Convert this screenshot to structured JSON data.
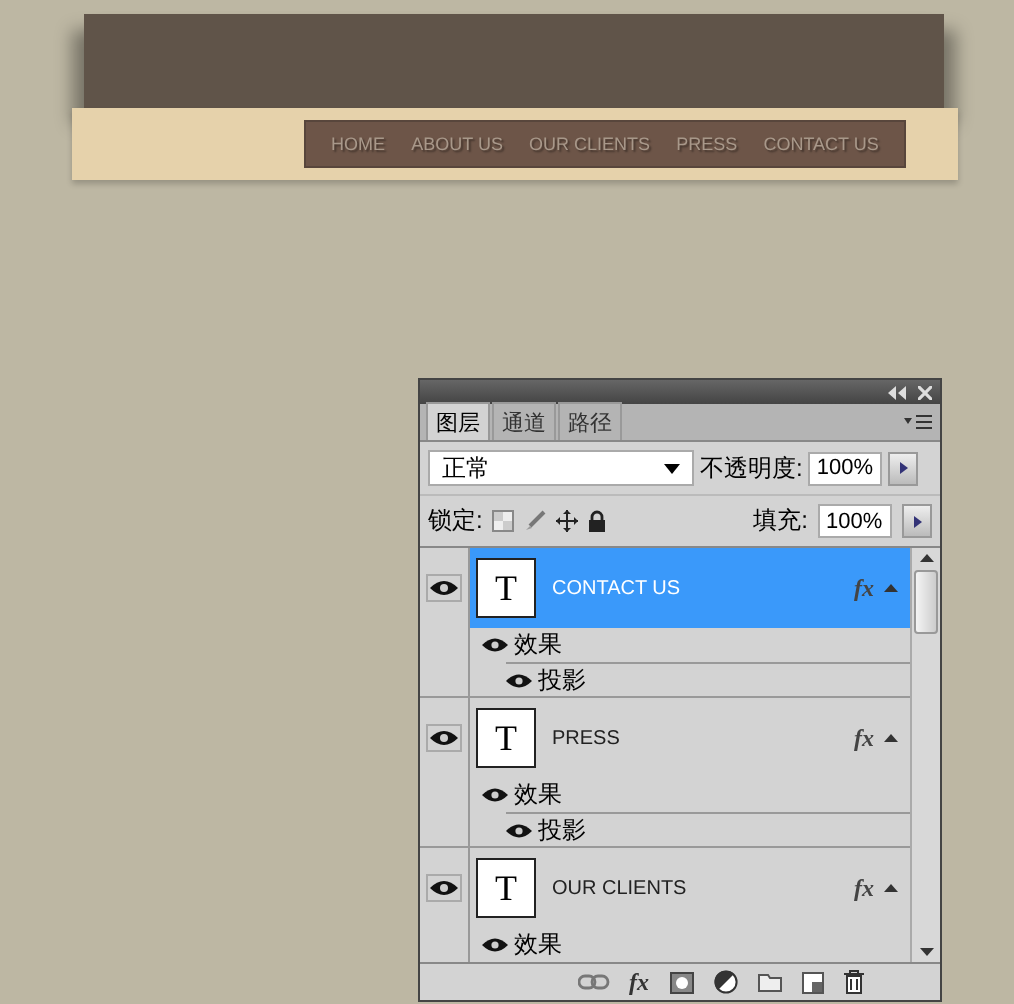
{
  "nav": {
    "items": [
      "HOME",
      "ABOUT US",
      "OUR CLIENTS",
      "PRESS",
      "CONTACT US"
    ]
  },
  "layers_panel": {
    "tabs": [
      {
        "label": "图层",
        "selected": true
      },
      {
        "label": "通道",
        "selected": false
      },
      {
        "label": "路径",
        "selected": false
      }
    ],
    "blend_mode": "正常",
    "opacity_label": "不透明度:",
    "opacity": "100%",
    "lock_label": "锁定:",
    "fill_label": "填充:",
    "fill": "100%",
    "layers": [
      {
        "thumb": "T",
        "name": "CONTACT US",
        "selected": true,
        "visible": true,
        "fx": "fx",
        "effects_label": "效果",
        "effects": [
          {
            "name": "投影",
            "visible": true
          }
        ]
      },
      {
        "thumb": "T",
        "name": "PRESS",
        "selected": false,
        "visible": true,
        "fx": "fx",
        "effects_label": "效果",
        "effects": [
          {
            "name": "投影",
            "visible": true
          }
        ]
      },
      {
        "thumb": "T",
        "name": "OUR CLIENTS",
        "selected": false,
        "visible": true,
        "fx": "fx",
        "effects_label": "效果"
      }
    ],
    "footer_fx": "fx"
  }
}
